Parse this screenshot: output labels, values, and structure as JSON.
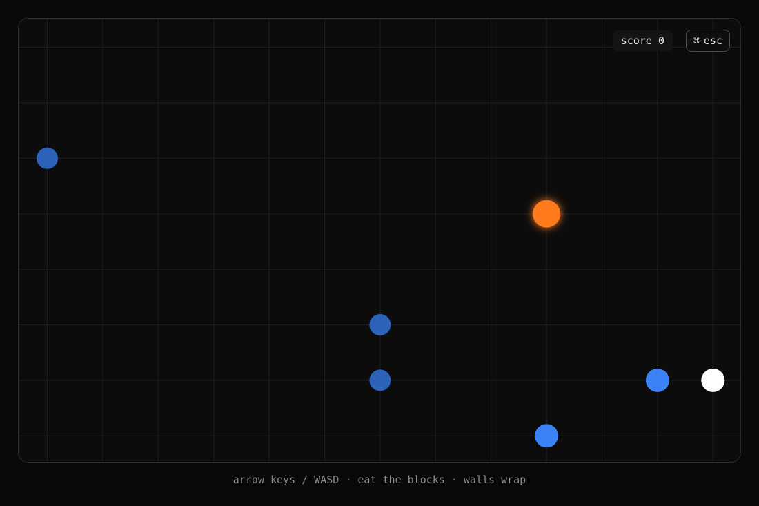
{
  "hud": {
    "score_label": "score",
    "score_value": "0",
    "esc_icon": "command-icon",
    "esc_glyph": "⌘",
    "esc_label": "esc"
  },
  "help": {
    "text": "arrow keys / WASD · eat the blocks · walls wrap"
  },
  "board": {
    "columns": 13,
    "rows": 8,
    "grid_color": "#1f1f22"
  },
  "snake": {
    "head_color": "#ffffff",
    "head": [
      12,
      6
    ],
    "body_color": "#3b82f6",
    "body": [
      [
        11,
        6
      ],
      [
        9,
        7
      ]
    ]
  },
  "food": {
    "color": "#ff7a1a",
    "cell": [
      9,
      3
    ]
  },
  "fading_dots": {
    "color": "#2c63b8",
    "cells": [
      [
        0,
        2
      ],
      [
        6,
        5
      ],
      [
        6,
        6
      ]
    ]
  }
}
